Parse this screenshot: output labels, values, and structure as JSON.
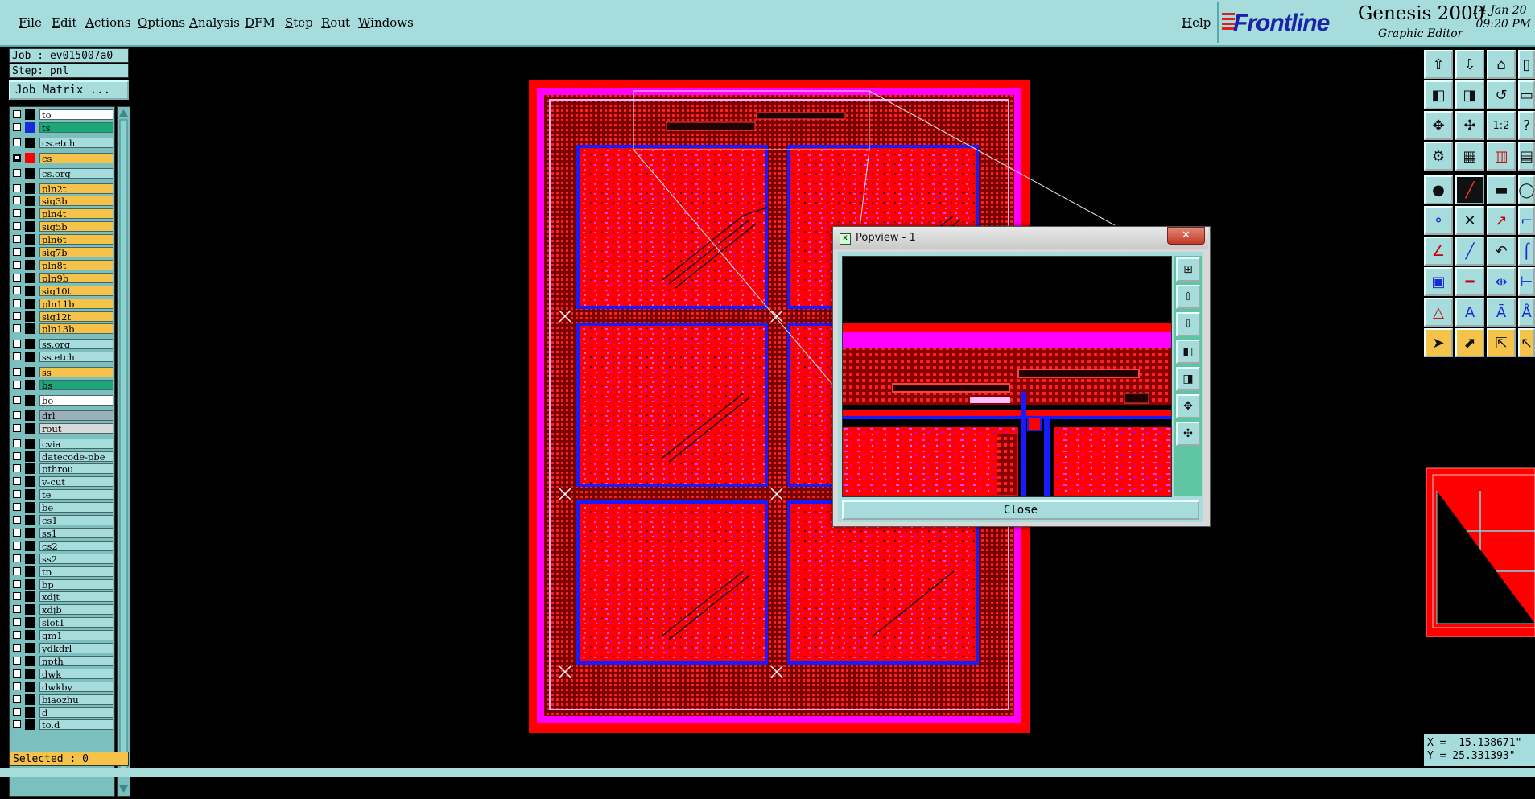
{
  "menubar": {
    "items": [
      "File",
      "Edit",
      "Actions",
      "Options",
      "Analysis",
      "DFM",
      "Step",
      "Rout",
      "Windows"
    ],
    "help": "Help"
  },
  "branding": {
    "logo": "Frontline",
    "product": "Genesis 2000",
    "subtitle": "Graphic Editor",
    "date": "14 Jan 20",
    "time": "09:20 PM"
  },
  "job": {
    "job_label": "Job : ev015007a0",
    "step_label": "Step: pnl",
    "matrix_button": "Job Matrix ..."
  },
  "layers": [
    {
      "name": "to",
      "color": "#ffffff",
      "checked": false,
      "swatch": "#000000"
    },
    {
      "name": "ts",
      "color": "#1aa878",
      "checked": false,
      "swatch": "#1a2ad8"
    },
    {
      "name": "cs.etch",
      "color": "#a6dcdc",
      "checked": false,
      "swatch": "#000000"
    },
    {
      "name": "cs",
      "color": "#f5c24a",
      "checked": true,
      "swatch": "#ff0000"
    },
    {
      "name": "cs.org",
      "color": "#a6dcdc",
      "checked": false,
      "swatch": "#000000"
    },
    {
      "name": "pln2t",
      "color": "#f5c24a",
      "checked": false,
      "swatch": "#000000"
    },
    {
      "name": "sig3b",
      "color": "#f5c24a",
      "checked": false,
      "swatch": "#000000"
    },
    {
      "name": "pln4t",
      "color": "#f5c24a",
      "checked": false,
      "swatch": "#000000"
    },
    {
      "name": "sig5b",
      "color": "#f5c24a",
      "checked": false,
      "swatch": "#000000"
    },
    {
      "name": "pln6t",
      "color": "#f5c24a",
      "checked": false,
      "swatch": "#000000"
    },
    {
      "name": "sig7b",
      "color": "#f5c24a",
      "checked": false,
      "swatch": "#000000"
    },
    {
      "name": "pln8t",
      "color": "#f5c24a",
      "checked": false,
      "swatch": "#000000"
    },
    {
      "name": "pln9b",
      "color": "#f5c24a",
      "checked": false,
      "swatch": "#000000"
    },
    {
      "name": "sig10t",
      "color": "#f5c24a",
      "checked": false,
      "swatch": "#000000"
    },
    {
      "name": "pln11b",
      "color": "#f5c24a",
      "checked": false,
      "swatch": "#000000"
    },
    {
      "name": "sig12t",
      "color": "#f5c24a",
      "checked": false,
      "swatch": "#000000"
    },
    {
      "name": "pln13b",
      "color": "#f5c24a",
      "checked": false,
      "swatch": "#000000"
    },
    {
      "name": "ss.org",
      "color": "#a6dcdc",
      "checked": false,
      "swatch": "#000000"
    },
    {
      "name": "ss.etch",
      "color": "#a6dcdc",
      "checked": false,
      "swatch": "#000000"
    },
    {
      "name": "ss",
      "color": "#f5c24a",
      "checked": false,
      "swatch": "#000000"
    },
    {
      "name": "bs",
      "color": "#1aa878",
      "checked": false,
      "swatch": "#000000"
    },
    {
      "name": "bo",
      "color": "#ffffff",
      "checked": false,
      "swatch": "#000000"
    },
    {
      "name": "drl",
      "color": "#9bb0b8",
      "checked": false,
      "swatch": "#000000"
    },
    {
      "name": "rout",
      "color": "#d8d8d8",
      "checked": false,
      "swatch": "#000000"
    },
    {
      "name": "cvia",
      "color": "#a6dcdc",
      "checked": false,
      "swatch": "#000000"
    },
    {
      "name": "datecode-pbe",
      "color": "#a6dcdc",
      "checked": false,
      "swatch": "#000000"
    },
    {
      "name": "pthrou",
      "color": "#a6dcdc",
      "checked": false,
      "swatch": "#000000"
    },
    {
      "name": "v-cut",
      "color": "#a6dcdc",
      "checked": false,
      "swatch": "#000000"
    },
    {
      "name": "te",
      "color": "#a6dcdc",
      "checked": false,
      "swatch": "#000000"
    },
    {
      "name": "be",
      "color": "#a6dcdc",
      "checked": false,
      "swatch": "#000000"
    },
    {
      "name": "cs1",
      "color": "#a6dcdc",
      "checked": false,
      "swatch": "#000000"
    },
    {
      "name": "ss1",
      "color": "#a6dcdc",
      "checked": false,
      "swatch": "#000000"
    },
    {
      "name": "cs2",
      "color": "#a6dcdc",
      "checked": false,
      "swatch": "#000000"
    },
    {
      "name": "ss2",
      "color": "#a6dcdc",
      "checked": false,
      "swatch": "#000000"
    },
    {
      "name": "tp",
      "color": "#a6dcdc",
      "checked": false,
      "swatch": "#000000"
    },
    {
      "name": "bp",
      "color": "#a6dcdc",
      "checked": false,
      "swatch": "#000000"
    },
    {
      "name": "xdjt",
      "color": "#a6dcdc",
      "checked": false,
      "swatch": "#000000"
    },
    {
      "name": "xdjb",
      "color": "#a6dcdc",
      "checked": false,
      "swatch": "#000000"
    },
    {
      "name": "slot1",
      "color": "#a6dcdc",
      "checked": false,
      "swatch": "#000000"
    },
    {
      "name": "gm1",
      "color": "#a6dcdc",
      "checked": false,
      "swatch": "#000000"
    },
    {
      "name": "ydkdrl",
      "color": "#a6dcdc",
      "checked": false,
      "swatch": "#000000"
    },
    {
      "name": "npth",
      "color": "#a6dcdc",
      "checked": false,
      "swatch": "#000000"
    },
    {
      "name": "dwk",
      "color": "#a6dcdc",
      "checked": false,
      "swatch": "#000000"
    },
    {
      "name": "dwkby",
      "color": "#a6dcdc",
      "checked": false,
      "swatch": "#000000"
    },
    {
      "name": "biaozhu",
      "color": "#a6dcdc",
      "checked": false,
      "swatch": "#000000"
    },
    {
      "name": "d",
      "color": "#a6dcdc",
      "checked": false,
      "swatch": "#000000"
    },
    {
      "name": "to.d",
      "color": "#a6dcdc",
      "checked": false,
      "swatch": "#000000"
    }
  ],
  "selected": "Selected : 0",
  "popview": {
    "title": "Popview - 1",
    "close_button": "Close",
    "close_x": "✕"
  },
  "coords": {
    "x": "X = -15.138671\"",
    "y": "Y = 25.331393\""
  },
  "colors": {
    "panel": "#a6dcdc",
    "board_red": "#ff0000",
    "board_magenta": "#ff00ff",
    "accent_yellow": "#f5c24a"
  }
}
